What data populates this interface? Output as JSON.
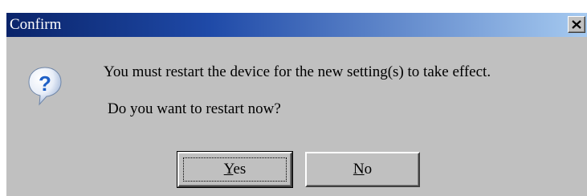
{
  "window": {
    "title": "Confirm",
    "close_icon": "close-icon"
  },
  "dialog": {
    "icon": "question-icon",
    "message_line1": "You must restart the device for the new setting(s) to take effect.",
    "message_line2": "Do you want to restart now?"
  },
  "buttons": {
    "yes": {
      "mnemonic": "Y",
      "rest": "es"
    },
    "no": {
      "mnemonic": "N",
      "rest": "o"
    }
  },
  "colors": {
    "titlebar_start": "#0a246a",
    "titlebar_end": "#a6caf0",
    "dialog_bg": "#c0c0c0",
    "icon_blue": "#1d5fc6"
  }
}
